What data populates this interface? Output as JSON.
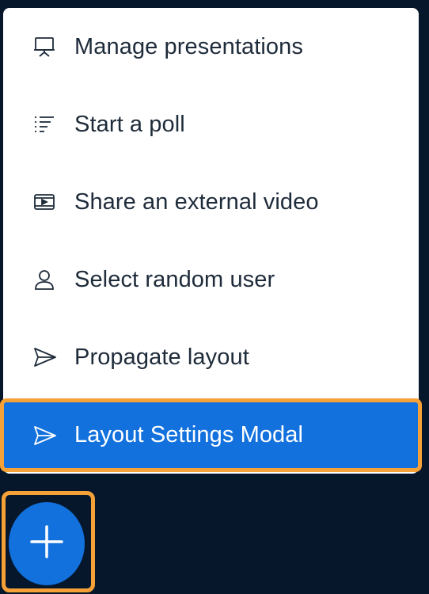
{
  "menu": {
    "items": [
      {
        "label": "Manage presentations",
        "icon": "presentation-icon"
      },
      {
        "label": "Start a poll",
        "icon": "poll-icon"
      },
      {
        "label": "Share an external video",
        "icon": "video-icon"
      },
      {
        "label": "Select random user",
        "icon": "user-icon"
      },
      {
        "label": "Propagate layout",
        "icon": "send-icon"
      },
      {
        "label": "Layout Settings Modal",
        "icon": "send-icon"
      }
    ]
  },
  "fab": {
    "icon": "plus-icon"
  },
  "colors": {
    "background": "#06172b",
    "menu": "#ffffff",
    "accent": "#1271dd",
    "highlight": "#f6a137",
    "text": "#1e2b3a"
  }
}
